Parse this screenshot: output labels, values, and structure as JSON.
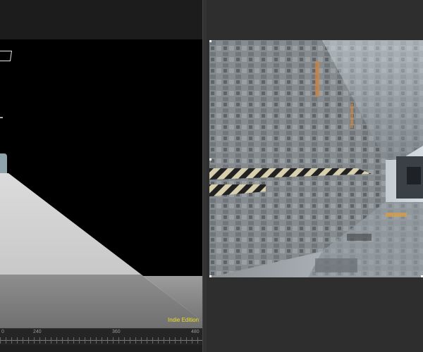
{
  "viewport": {
    "watermark": "Indie Edition"
  },
  "timeline": {
    "labels": [
      "240",
      "360",
      "480"
    ]
  },
  "render": {
    "description_icon": "sci-fi-corridor-render"
  },
  "colors": {
    "watermark": "#f0e020",
    "viewport_bg": "#000000",
    "panel_bg": "#2b2b2b"
  }
}
